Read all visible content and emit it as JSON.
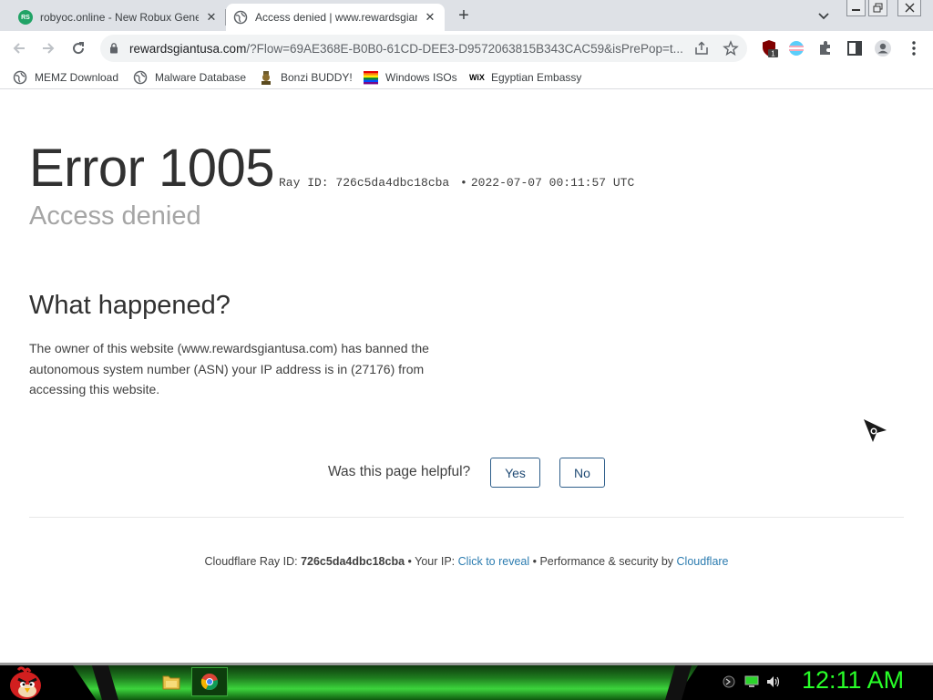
{
  "browser": {
    "tabs": [
      {
        "title": "robyoc.online - New Robux Generator",
        "favicon": "RS"
      },
      {
        "title": "Access denied | www.rewardsgiantusa.com",
        "favicon": "globe-icon"
      }
    ],
    "url_host": "rewardsgiantusa.com",
    "url_rest": "/?Flow=69AE368E-B0B0-61CD-DEE3-D9572063815B343CAC59&isPrePop=t...",
    "extension_badge": "1"
  },
  "bookmarks": [
    {
      "label": "MEMZ Download",
      "icon": "globe-icon"
    },
    {
      "label": "Malware Database",
      "icon": "globe-icon"
    },
    {
      "label": "Bonzi BUDDY!",
      "icon": "bonzi-icon"
    },
    {
      "label": "Windows ISOs",
      "icon": "rainbow-flag-icon"
    },
    {
      "label": "Egyptian Embassy",
      "icon": "wix-icon"
    }
  ],
  "page": {
    "error_title": "Error 1005",
    "ray_label": "Ray ID: 726c5da4dbc18cba",
    "ray_sep": "•",
    "timestamp": "2022-07-07 00:11:57 UTC",
    "subtitle": "Access denied",
    "what_heading": "What happened?",
    "description": "The owner of this website (www.rewardsgiantusa.com) has banned the autonomous system number (ASN) your IP address is in (27176) from accessing this website.",
    "helpful_question": "Was this page helpful?",
    "yes": "Yes",
    "no": "No",
    "footer": {
      "ray_prefix": "Cloudflare Ray ID: ",
      "ray_id": "726c5da4dbc18cba",
      "sep1": " • Your IP: ",
      "ip_link": "Click to reveal",
      "sep2": " • Performance & security by ",
      "cf_link": "Cloudflare"
    }
  },
  "taskbar": {
    "clock": "12:11 AM",
    "accent": "#28ff28"
  }
}
